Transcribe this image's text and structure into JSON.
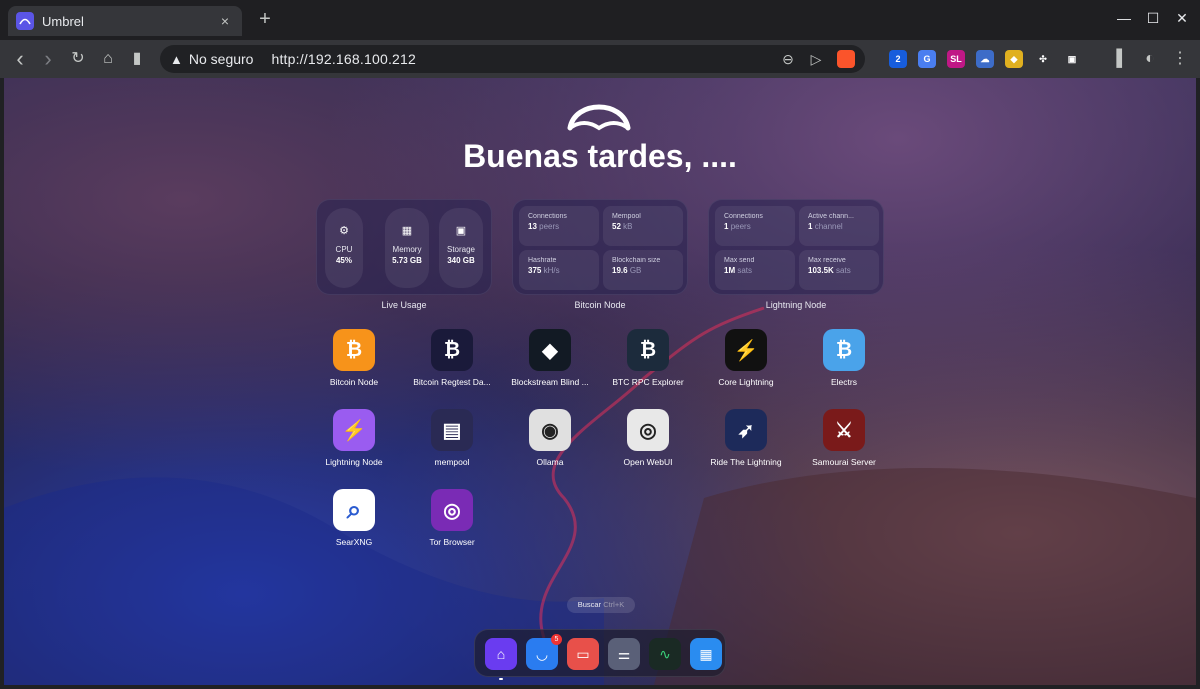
{
  "browser": {
    "tab_title": "Umbrel",
    "tab_close": "×",
    "new_tab": "+",
    "window_controls": {
      "minimize": "—",
      "maximize": "☐",
      "close": "✕"
    },
    "toolbar": {
      "back": "‹",
      "forward": "›",
      "reload": "↻",
      "home": "⌂",
      "bookmark": "▮",
      "security_warning_icon": "▲",
      "security_text": "No seguro",
      "url": "http://192.168.100.212",
      "zoom_icon": "⊖",
      "share_icon": "▷"
    },
    "extensions": [
      {
        "name": "bitwarden-icon",
        "label": "2",
        "color": "#175ddc"
      },
      {
        "name": "translate-icon",
        "label": "G",
        "color": "#4a7ef0"
      },
      {
        "name": "sl-extension-icon",
        "label": "SL",
        "color": "#c01886"
      },
      {
        "name": "cloud-extension-icon",
        "label": "☁",
        "color": "#3d6cc8"
      },
      {
        "name": "extension-icon-2",
        "label": "◆",
        "color": "#e0b020"
      },
      {
        "name": "puzzle-icon",
        "label": "✣",
        "color": "#35363a"
      },
      {
        "name": "screenshot-icon",
        "label": "▣",
        "color": "#35363a"
      }
    ],
    "menu_icons": {
      "sidebar": "▌",
      "theme": "◐",
      "menu": "⋮"
    }
  },
  "page": {
    "greeting": "Buenas tardes, ....",
    "search_hint": "Buscar",
    "search_shortcut": "Ctrl+K",
    "widgets": {
      "live_usage": {
        "caption": "Live Usage",
        "items": [
          {
            "icon": "⚙",
            "label": "CPU",
            "value": "45%"
          },
          {
            "icon": "▦",
            "label": "Memory",
            "value": "5.73 GB"
          },
          {
            "icon": "▣",
            "label": "Storage",
            "value": "340 GB"
          }
        ]
      },
      "bitcoin_node": {
        "caption": "Bitcoin Node",
        "stats": [
          {
            "label": "Connections",
            "value": "13",
            "unit": "peers"
          },
          {
            "label": "Mempool",
            "value": "52",
            "unit": "kB"
          },
          {
            "label": "Hashrate",
            "value": "375",
            "unit": "kH/s"
          },
          {
            "label": "Blockchain size",
            "value": "19.6",
            "unit": "GB"
          }
        ]
      },
      "lightning_node": {
        "caption": "Lightning Node",
        "stats": [
          {
            "label": "Connections",
            "value": "1",
            "unit": "peers"
          },
          {
            "label": "Active chann...",
            "value": "1",
            "unit": "channel"
          },
          {
            "label": "Max send",
            "value": "1M",
            "unit": "sats"
          },
          {
            "label": "Max receive",
            "value": "103.5K",
            "unit": "sats"
          }
        ]
      }
    },
    "apps": [
      {
        "label": "Bitcoin Node",
        "glyph": "₿",
        "color": "#f7931a"
      },
      {
        "label": "Bitcoin Regtest Da...",
        "glyph": "₿",
        "color": "#1a1a3a"
      },
      {
        "label": "Blockstream Blind ...",
        "glyph": "◆",
        "color": "#121a24"
      },
      {
        "label": "BTC RPC Explorer",
        "glyph": "₿",
        "color": "#1c2b3c"
      },
      {
        "label": "Core Lightning",
        "glyph": "⚡",
        "color": "#111111"
      },
      {
        "label": "Electrs",
        "glyph": "₿",
        "color": "#4aa3ea"
      },
      {
        "label": "Lightning Node",
        "glyph": "⚡",
        "color": "#9a5cf0"
      },
      {
        "label": "mempool",
        "glyph": "▤",
        "color": "#2a2a54"
      },
      {
        "label": "Ollama",
        "glyph": "◉",
        "color": "#e0e0e0"
      },
      {
        "label": "Open WebUI",
        "glyph": "◎",
        "color": "#e8e8e8"
      },
      {
        "label": "Ride The Lightning",
        "glyph": "➶",
        "color": "#1d2a5a"
      },
      {
        "label": "Samourai Server",
        "glyph": "⚔",
        "color": "#7a1a1a"
      },
      {
        "label": "SearXNG",
        "glyph": "⌕",
        "color": "#ffffff"
      },
      {
        "label": "Tor Browser",
        "glyph": "◎",
        "color": "#7a2bb5"
      }
    ],
    "dock": [
      {
        "name": "dock-home-icon",
        "glyph": "⌂",
        "color": "#6a3cf0"
      },
      {
        "name": "dock-app-store-icon",
        "glyph": "◡",
        "color": "#2a7cf0",
        "badge": "5"
      },
      {
        "name": "dock-backups-icon",
        "glyph": "▭",
        "color": "#e8504a"
      },
      {
        "name": "dock-settings-icon",
        "glyph": "⚌",
        "color": "#5a6078"
      },
      {
        "name": "dock-live-usage-icon",
        "glyph": "∿",
        "color": "#1a2a24"
      },
      {
        "name": "dock-widgets-icon",
        "glyph": "▦",
        "color": "#2a8cf0"
      }
    ]
  }
}
